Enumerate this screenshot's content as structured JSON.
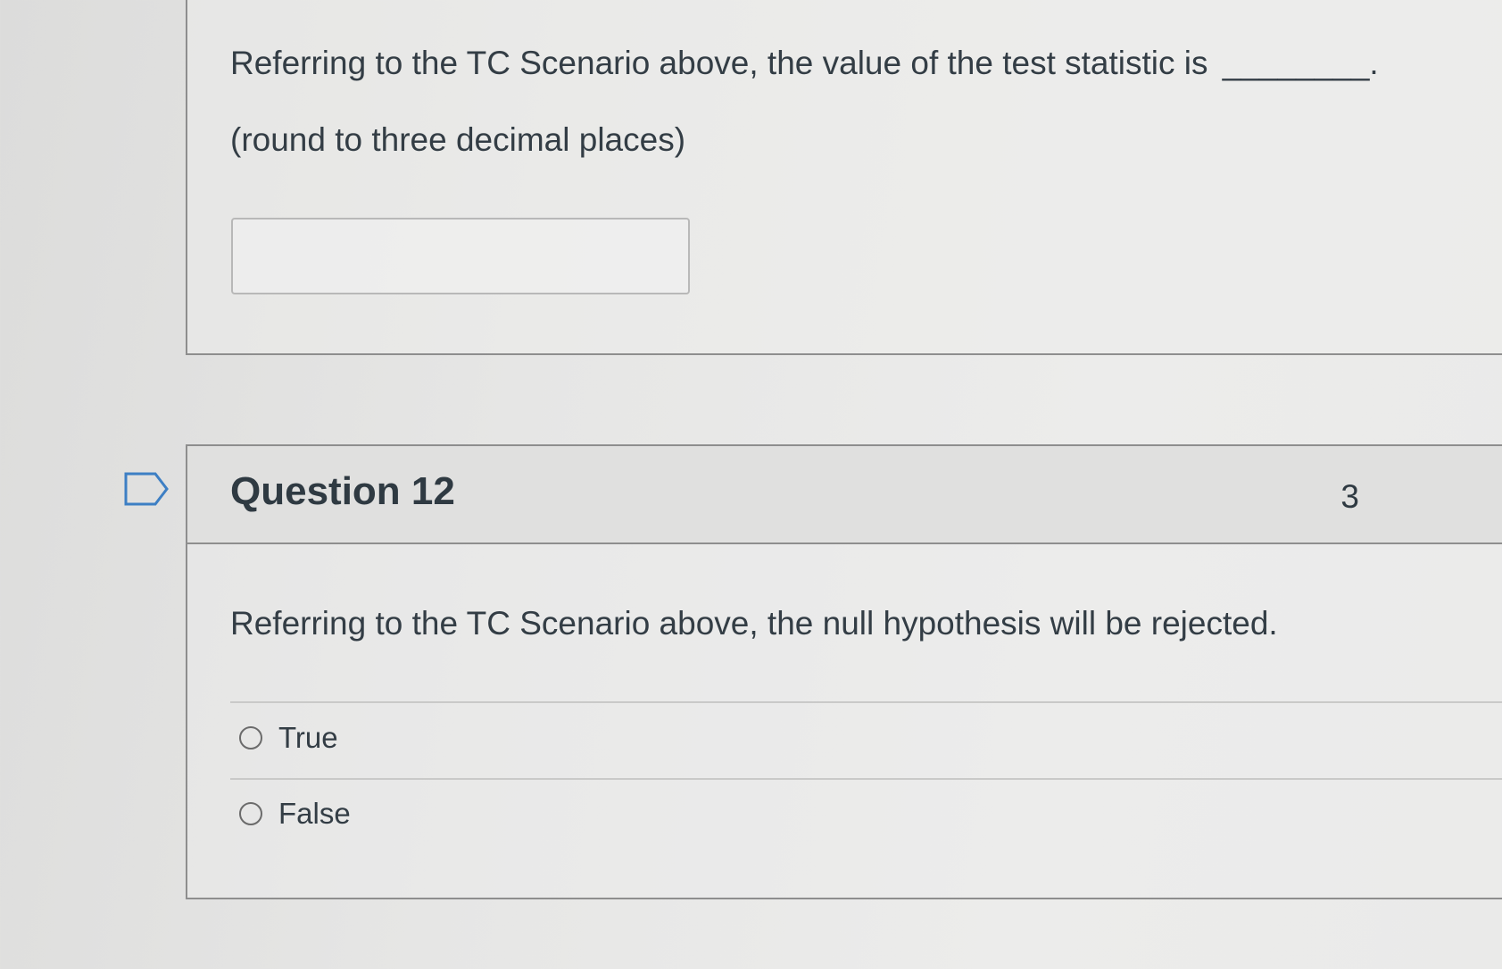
{
  "question_11": {
    "prompt": "Referring to the TC Scenario above, the value of the test statistic is",
    "blank": "________.",
    "note": "(round to three decimal places)",
    "answer_value": "",
    "answer_placeholder": ""
  },
  "question_12": {
    "title": "Question 12",
    "points": "3",
    "prompt": "Referring to the TC Scenario above, the null hypothesis will be rejected.",
    "options": [
      {
        "label": "True",
        "selected": false
      },
      {
        "label": "False",
        "selected": false
      }
    ]
  },
  "icons": {
    "flag": "flag-icon",
    "radio": "radio-button"
  }
}
